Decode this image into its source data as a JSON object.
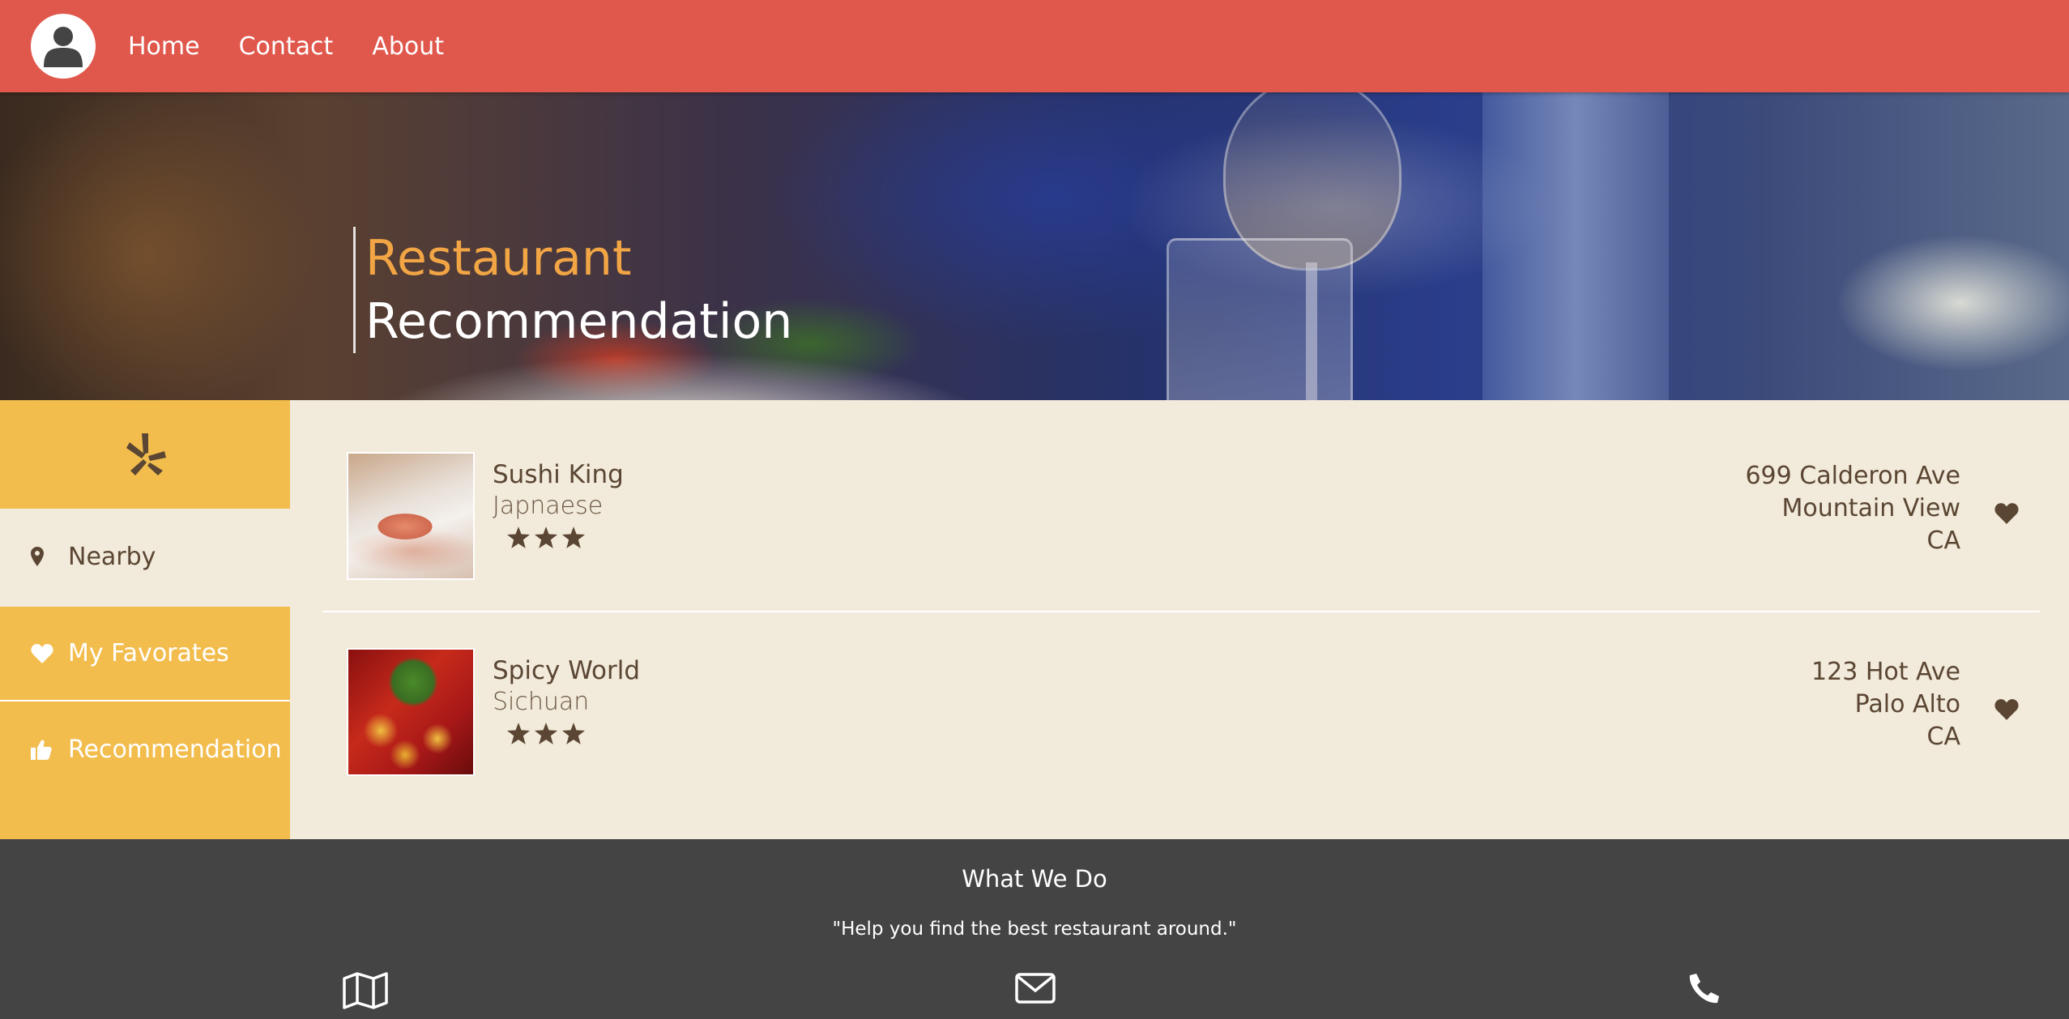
{
  "header": {
    "nav": [
      {
        "label": "Home"
      },
      {
        "label": "Contact"
      },
      {
        "label": "About"
      }
    ],
    "bg_color": "#e0574c"
  },
  "hero": {
    "title_line1": "Restaurant",
    "title_line2": "Recommendation",
    "accent_color": "#f2a544"
  },
  "sidebar": {
    "logo_icon": "yelp-icon",
    "items": [
      {
        "label": "Nearby",
        "icon": "map-pin-icon"
      },
      {
        "label": "My Favorates",
        "icon": "heart-icon"
      },
      {
        "label": "Recommendation",
        "icon": "thumbs-up-icon"
      }
    ],
    "accent_color": "#f2bd4d"
  },
  "restaurants": [
    {
      "name": "Sushi King",
      "category": "Japnaese",
      "rating": 3,
      "address_line1": "699 Calderon Ave",
      "address_line2": "Mountain View",
      "address_line3": "CA",
      "favorite": true
    },
    {
      "name": "Spicy World",
      "category": "Sichuan",
      "rating": 3,
      "address_line1": "123 Hot Ave",
      "address_line2": "Palo Alto",
      "address_line3": "CA",
      "favorite": true
    }
  ],
  "footer": {
    "title": "What We Do",
    "tagline": "\"Help you find the best restaurant around.\"",
    "contacts": [
      {
        "icon": "map-icon"
      },
      {
        "icon": "envelope-icon"
      },
      {
        "icon": "phone-icon"
      }
    ]
  }
}
